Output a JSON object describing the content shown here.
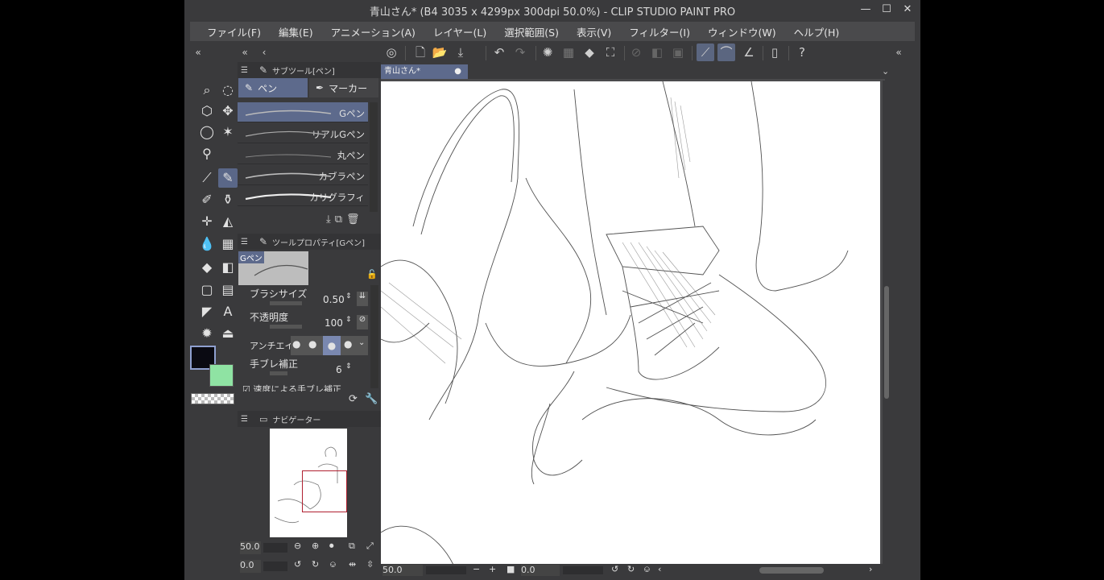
{
  "window": {
    "title": "青山さん* (B4 3035 x 4299px 300dpi 50.0%)  - CLIP STUDIO PAINT PRO",
    "minimize": "—",
    "maximize": "☐",
    "close": "✕"
  },
  "menu": [
    "ファイル(F)",
    "編集(E)",
    "アニメーション(A)",
    "レイヤー(L)",
    "選択範囲(S)",
    "表示(V)",
    "フィルター(I)",
    "ウィンドウ(W)",
    "ヘルプ(H)"
  ],
  "subtool": {
    "header": "サブツール[ペン]",
    "tabs": [
      "ペン",
      "マーカー"
    ],
    "brushes": [
      "Gペン",
      "リアルGペン",
      "丸ペン",
      "カブラペン",
      "カリグラフィ"
    ]
  },
  "toolprop": {
    "header": "ツールプロパティ[Gペン]",
    "preview_label": "Gペン",
    "brush_size_label": "ブラシサイズ",
    "brush_size_value": "0.50",
    "opacity_label": "不透明度",
    "opacity_value": "100",
    "antialias_label": "アンチエイリ",
    "stabilization_label": "手ブレ補正",
    "stabilization_value": "6",
    "speed_label": "速度による手ブレ補正"
  },
  "navigator": {
    "header": "ナビゲーター",
    "zoom": "50.0",
    "rotation": "0.0"
  },
  "document": {
    "tab_label": "青山さん*"
  },
  "status": {
    "zoom": "50.0",
    "rotation": "0.0"
  },
  "colors": {
    "main": "#0a0a12",
    "sub": "#8fe3a3",
    "accent": "#5b6680"
  }
}
